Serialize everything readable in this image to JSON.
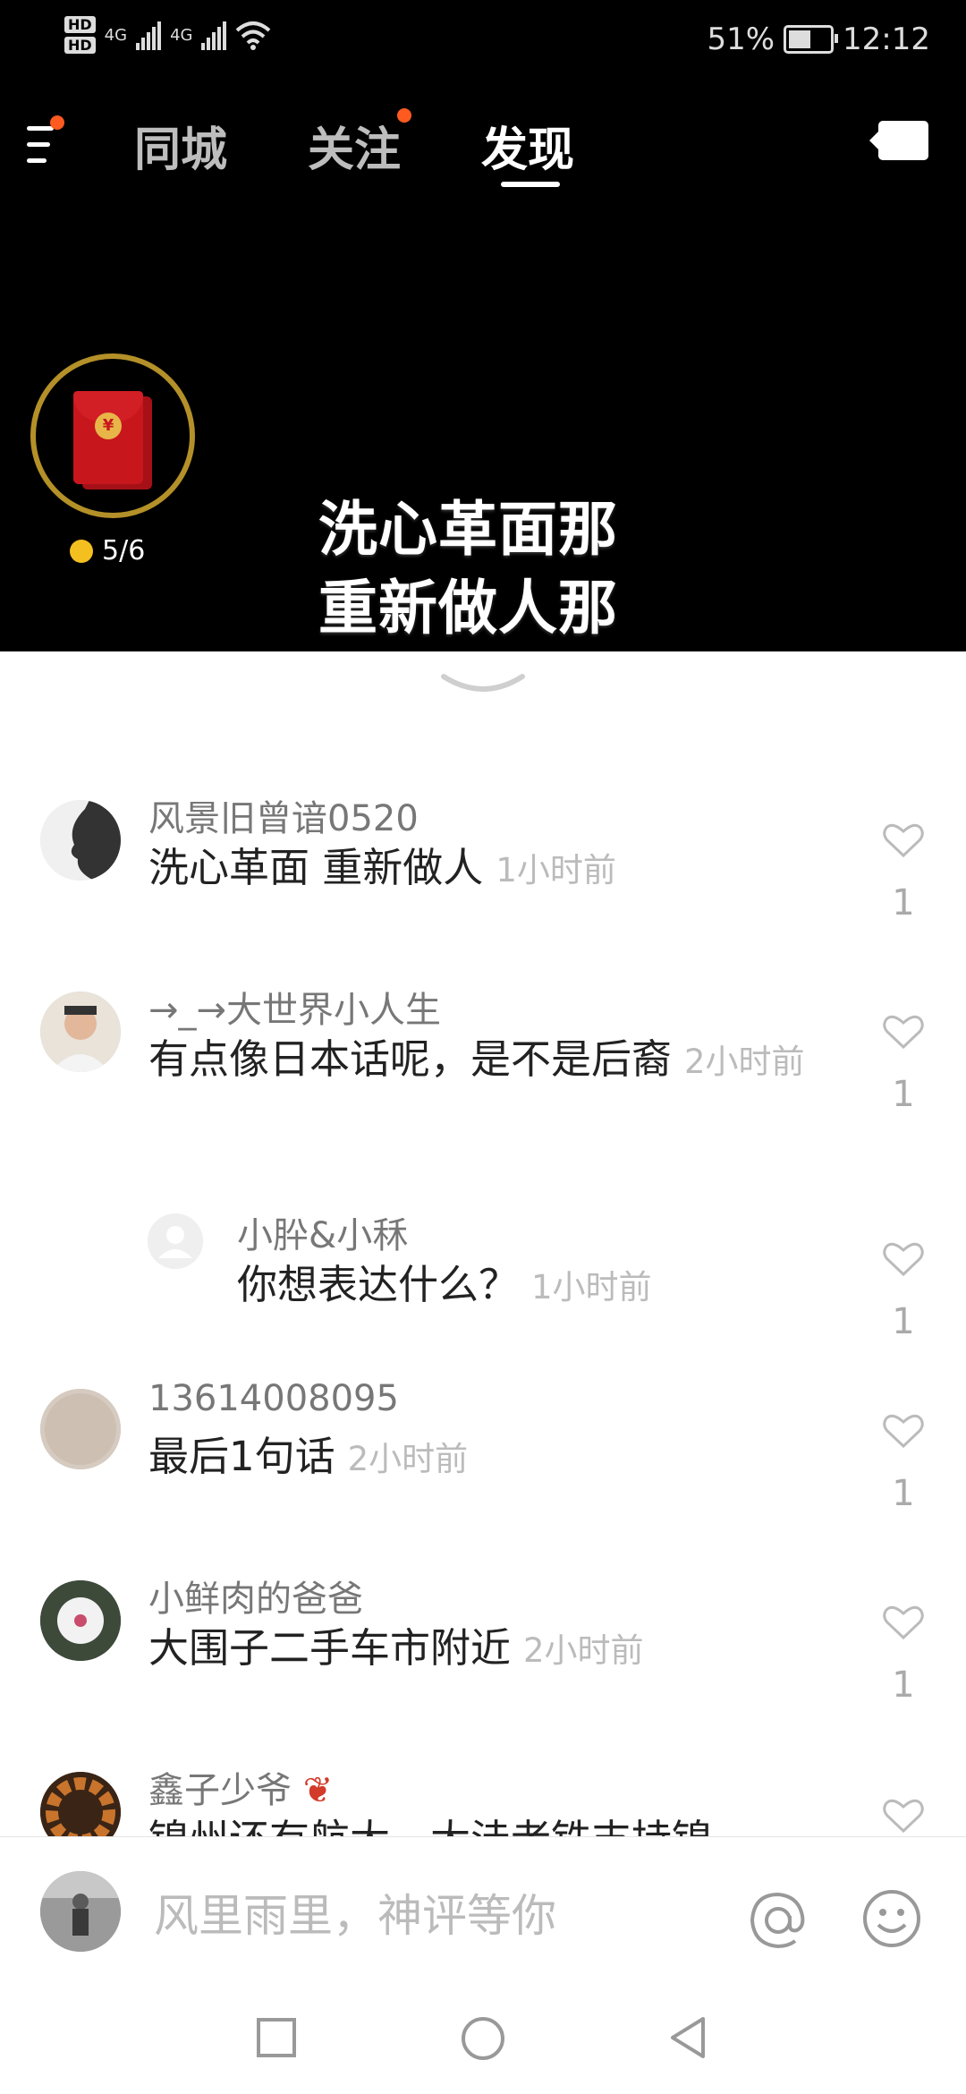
{
  "status_bar": {
    "hd1": "HD",
    "hd2": "HD",
    "network1": "4G",
    "network2": "4G",
    "battery": "51%",
    "time": "12:12"
  },
  "nav": {
    "tabs": [
      {
        "label": "同城",
        "active": false,
        "dot": false
      },
      {
        "label": "关注",
        "active": false,
        "dot": true
      },
      {
        "label": "发现",
        "active": true,
        "dot": false
      }
    ],
    "menu_dot": true,
    "icons": {
      "menu": "menu-icon",
      "camera": "camera-icon"
    }
  },
  "red_packet": {
    "progress": "5/6",
    "currency_symbol": "¥"
  },
  "video_caption": {
    "line1": "洗心革面那",
    "line2": "重新做人那"
  },
  "comments": [
    {
      "user": "风景旧曾谙0520",
      "text": "洗心革面 重新做人",
      "time": "1小时前",
      "likes": "1",
      "reply": false
    },
    {
      "user": "→_→大世界小人生",
      "text": "有点像日本话呢，是不是后裔",
      "time": "2小时前",
      "likes": "1",
      "reply": false
    },
    {
      "user": "小肸&小秝",
      "text": "你想表达什么？",
      "time": "1小时前",
      "likes": "1",
      "reply": true
    },
    {
      "user": "13614008095",
      "text": "最后1句话",
      "time": "2小时前",
      "likes": "1",
      "reply": false
    },
    {
      "user": "小鲜肉的爸爸",
      "text": "大围子二手车市附近",
      "time": "2小时前",
      "likes": "1",
      "reply": false
    },
    {
      "user": "鑫子少爷",
      "text": "锦州还有航大，大洼老铁支持锦",
      "time": "",
      "likes": "",
      "reply": false
    }
  ],
  "input_bar": {
    "placeholder": "风里雨里，神评等你"
  },
  "colors": {
    "accent_dot": "#ff5a1f",
    "ring": "#b49028",
    "envelope": "#c8161d"
  }
}
